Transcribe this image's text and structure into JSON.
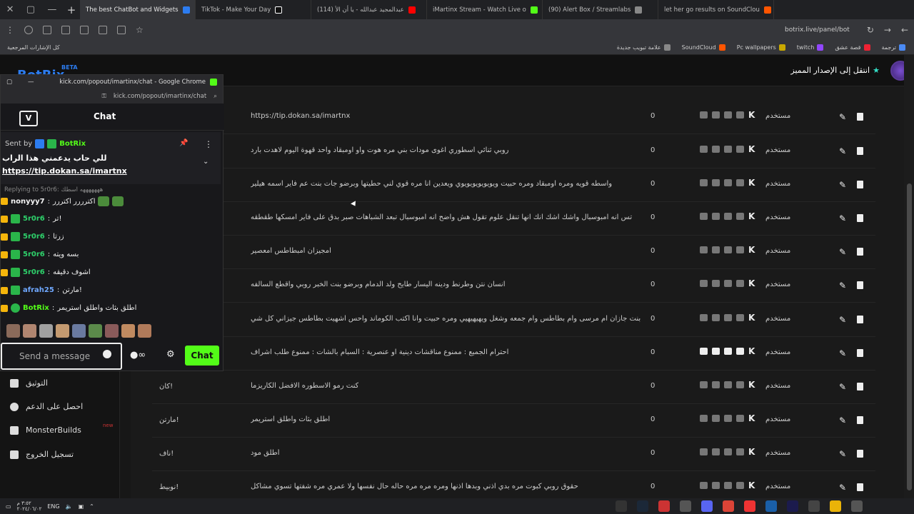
{
  "browser": {
    "tabs": [
      {
        "title": "The best ChatBot and Widgets",
        "active": true,
        "color": "#2c7cf0"
      },
      {
        "title": "TikTok - Make Your Day",
        "active": false,
        "color": "#ffffff"
      },
      {
        "title": "(114) عبدالمجيد عبدالله - يا أن الأ",
        "active": false,
        "color": "#ff0000"
      },
      {
        "title": "iMartinx Stream - Watch Live o",
        "active": false,
        "color": "#53fc18"
      },
      {
        "title": "(90) Alert Box / Streamlabs",
        "active": false,
        "color": "#888888"
      },
      {
        "title": "let her go results on SoundClou",
        "active": false,
        "color": "#ff5500"
      }
    ],
    "url": "botrix.live/panel/bot",
    "bookmarks": [
      "ترجمة",
      "قصة عشق",
      "twitch",
      "Pc wallpapers",
      "SoundCloud",
      "علامة تبويب جديدة"
    ],
    "all_bookmarks_label": "كل الإشارات المرجعية"
  },
  "header": {
    "logo": "BotRix",
    "beta": "BETA",
    "premium_label": "انتقل إلى الإصدار المميز"
  },
  "sidebar": {
    "items": [
      {
        "label": "التوثيق"
      },
      {
        "label": "احصل على الدعم"
      },
      {
        "label": "MonsterBuilds",
        "badge": "new"
      },
      {
        "label": "تسجيل الخروج"
      }
    ]
  },
  "commands": {
    "rows": [
      {
        "cmd": "",
        "response": "https://tip.dokan.sa/imartnx",
        "count": "0",
        "perm": "مستخدم"
      },
      {
        "cmd": "",
        "response": "روبي ثنائي اسطوري اغوى مودات بني مره هوت واو اومبقاد واحد قهوة اليوم لاهدت بارد",
        "count": "0",
        "perm": "مستخدم"
      },
      {
        "cmd": "",
        "response": "واسطه قويه ومره اومبقاد ومره حبيت ويويويويويويوي ويعدين انا مره قوي لني حطيتها وبرضو جات بنت عم فاير اسمه هيلير",
        "count": "0",
        "perm": "مستخدم"
      },
      {
        "cmd": "",
        "response": "تس انه امبوسبال واشك اشك انك انها تنقل علوم تقول هش واضح انه امبوسبال تبعد الشباهات صبر بدق على فاير امسكها طقطقه",
        "count": "0",
        "perm": "مستخدم"
      },
      {
        "cmd": "",
        "response": "امجيزان امبطاطس امعصير",
        "count": "0",
        "perm": "مستخدم"
      },
      {
        "cmd": "",
        "response": "انسان نتن وطرنط ودينه اليسار طايح ولد الدمام وبرضو بنت الخبر روبي واقطع السالفه",
        "count": "0",
        "perm": "مستخدم"
      },
      {
        "cmd": "",
        "response": "بنت جازان ام مرسى وام بطاطس وام جمعه وشغل ويهيهيهيي ومره حبيت وانا اكتب الكوماند واحس اشهيت بطاطس جيزاني كل شي",
        "count": "0",
        "perm": "مستخدم"
      },
      {
        "cmd": "",
        "response": "احترام الجميع : ممنوع مناقشات دينية او عنصرية : السبام بالشات : ممنوع طلب اشراف",
        "count": "0",
        "perm": "مستخدم"
      },
      {
        "cmd": "كان!",
        "response": "كنت رمو الاسطوره الافضل الكاريزما",
        "count": "0",
        "perm": "مستخدم"
      },
      {
        "cmd": "مارتن!",
        "response": "اطلق بثات واطلق استريمر",
        "count": "0",
        "perm": "مستخدم"
      },
      {
        "cmd": "ناف!",
        "response": "أطلق مود",
        "count": "0",
        "perm": "مستخدم"
      },
      {
        "cmd": "نوبيط!",
        "response": "حقوق روبي كبوت مره بدي اذني وبدها اذنها ومره مره مره حاله حال نفسها ولا عمري مره شفتها تسوي مشاكل",
        "count": "0",
        "perm": "مستخدم"
      }
    ]
  },
  "popout": {
    "window_title": "kick.com/popout/imartinx/chat - Google Chrome",
    "url": "kick.com/popout/imartinx/chat",
    "header": "Chat",
    "pinned_sent_by": "Sent by",
    "pinned_user": "BotRix",
    "pinned_message": "للي حاب يدعمني هذا الراب",
    "pinned_link": "https://tip.dokan.sa/imartnx",
    "replying": "Replying to 5r0r6: هههههههه اسطك",
    "messages": [
      {
        "user": "nonyyy7",
        "text": "اكترررر اكتررر"
      },
      {
        "user": "5r0r6",
        "text": "تر!"
      },
      {
        "user": "5r0r6",
        "text": "زرتا"
      },
      {
        "user": "5r0r6",
        "text": "بسه ويته"
      },
      {
        "user": "5r0r6",
        "text": "اشوف دقيقه"
      },
      {
        "user": "afrah25",
        "text": "مارتن!"
      },
      {
        "user": "BotRix",
        "text": "اطلق بثات واطلق استريمر"
      }
    ],
    "input_placeholder": "Send a message",
    "send_label": "Chat"
  },
  "taskbar": {
    "lang": "ENG",
    "time": "٣:٥٢ م",
    "date": "٢٠٢٤/٠٦/٠٢"
  }
}
